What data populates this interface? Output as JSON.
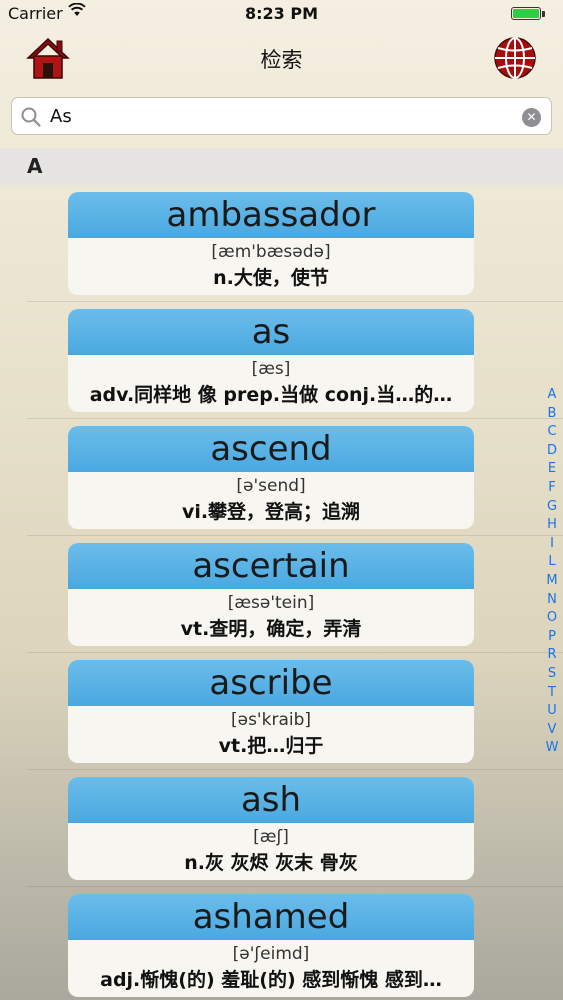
{
  "status": {
    "carrier": "Carrier",
    "time": "8:23 PM",
    "battery_level": 1.0
  },
  "nav": {
    "title": "检索",
    "home_icon": "home-icon",
    "globe_icon": "globe-icon"
  },
  "search": {
    "value": "As",
    "placeholder": ""
  },
  "section": {
    "letter": "A"
  },
  "words": [
    {
      "word": "ambassador",
      "pron": "[æm'bæsədə]",
      "def": "n.大使，使节"
    },
    {
      "word": "as",
      "pron": "[æs]",
      "def": "adv.同样地 像 prep.当做 conj.当…的…"
    },
    {
      "word": "ascend",
      "pron": "[ə'send]",
      "def": "vi.攀登，登高；追溯"
    },
    {
      "word": "ascertain",
      "pron": "[æsə'tein]",
      "def": "vt.查明，确定，弄清"
    },
    {
      "word": "ascribe",
      "pron": "[əs'kraib]",
      "def": "vt.把…归于"
    },
    {
      "word": "ash",
      "pron": "[æʃ]",
      "def": "n.灰 灰烬 灰末 骨灰"
    },
    {
      "word": "ashamed",
      "pron": "[ə'ʃeimd]",
      "def": "adj.惭愧(的) 羞耻(的) 感到惭愧 感到…"
    }
  ],
  "index": [
    "A",
    "B",
    "C",
    "D",
    "E",
    "F",
    "G",
    "H",
    "I",
    "L",
    "M",
    "N",
    "O",
    "P",
    "R",
    "S",
    "T",
    "U",
    "V",
    "W"
  ],
  "colors": {
    "card_header": "#4aa8e0",
    "index_text": "#1a73e8",
    "battery": "#2fcc45"
  }
}
